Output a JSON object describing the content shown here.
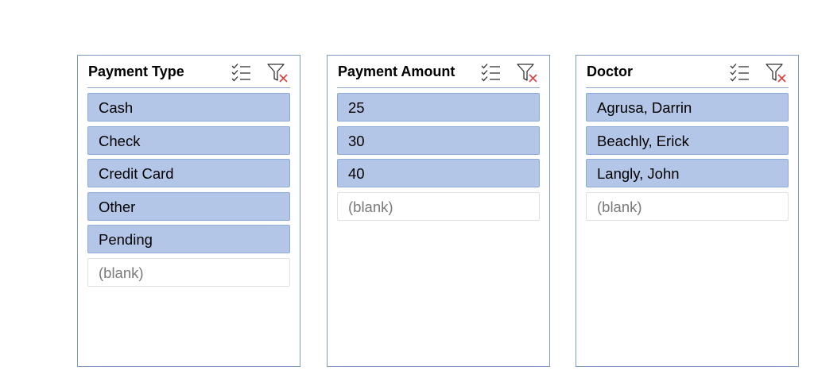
{
  "colors": {
    "selected_fill": "#b4c6e7",
    "selected_border": "#8eaad6",
    "frame_border": "#7f9bc4",
    "clear_x": "#e04040"
  },
  "slicers": [
    {
      "title": "Payment Type",
      "icons": [
        "multi-select-icon",
        "clear-filter-icon"
      ],
      "items": [
        {
          "label": "Cash",
          "selected": true
        },
        {
          "label": "Check",
          "selected": true
        },
        {
          "label": "Credit Card",
          "selected": true
        },
        {
          "label": "Other",
          "selected": true
        },
        {
          "label": "Pending",
          "selected": true
        },
        {
          "label": "(blank)",
          "selected": false
        }
      ]
    },
    {
      "title": "Payment Amount",
      "icons": [
        "multi-select-icon",
        "clear-filter-icon"
      ],
      "items": [
        {
          "label": "25",
          "selected": true
        },
        {
          "label": "30",
          "selected": true
        },
        {
          "label": "40",
          "selected": true
        },
        {
          "label": "(blank)",
          "selected": false
        }
      ]
    },
    {
      "title": "Doctor",
      "icons": [
        "multi-select-icon",
        "clear-filter-icon"
      ],
      "items": [
        {
          "label": "Agrusa, Darrin",
          "selected": true
        },
        {
          "label": "Beachly, Erick",
          "selected": true
        },
        {
          "label": "Langly, John",
          "selected": true
        },
        {
          "label": "(blank)",
          "selected": false
        }
      ]
    }
  ]
}
